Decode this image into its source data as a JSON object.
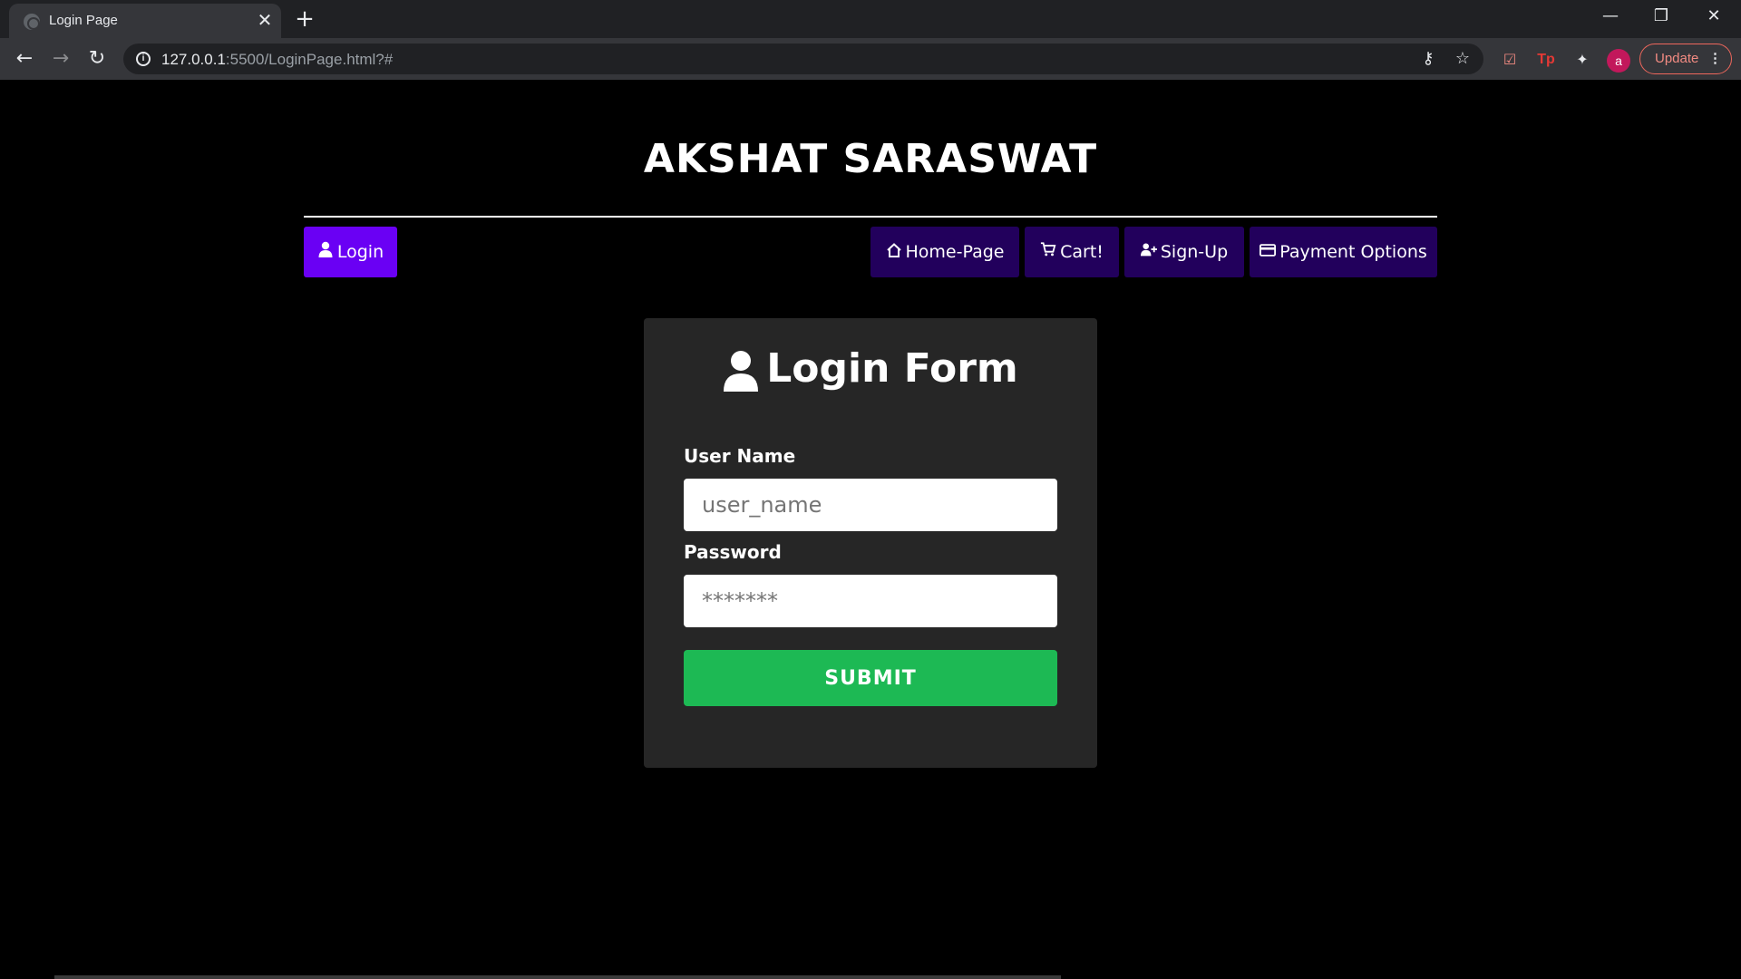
{
  "browser": {
    "tab_title": "Login Page",
    "tab_close": "✕",
    "new_tab": "+",
    "url_host": "127.0.0.1",
    "url_rest": ":5500/LoginPage.html?#",
    "update_label": "Update",
    "profile_initial": "a"
  },
  "site": {
    "title": "AKSHAT SARASWAT"
  },
  "nav": {
    "login": "Login",
    "home": "Home-Page",
    "cart": "Cart!",
    "signup": "Sign-Up",
    "payment": "Payment Options"
  },
  "form": {
    "title": "Login Form",
    "username_label": "User Name",
    "username_placeholder": "user_name",
    "password_label": "Password",
    "password_placeholder": "*******",
    "submit_label": "SUBMIT"
  },
  "colors": {
    "active_nav": "#6a00f4",
    "nav": "#22005c",
    "submit": "#1db954",
    "card": "#262626"
  }
}
